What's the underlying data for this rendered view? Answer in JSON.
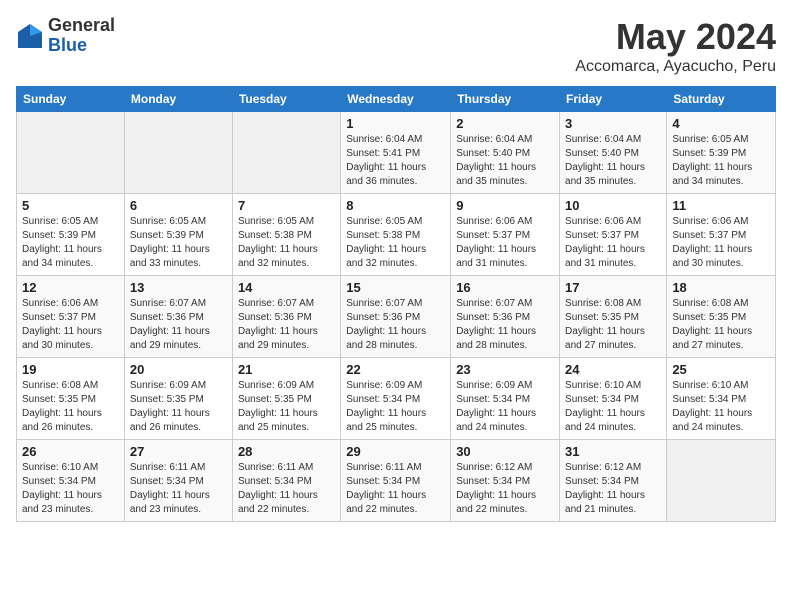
{
  "logo": {
    "general": "General",
    "blue": "Blue"
  },
  "title": "May 2024",
  "subtitle": "Accomarca, Ayacucho, Peru",
  "days_of_week": [
    "Sunday",
    "Monday",
    "Tuesday",
    "Wednesday",
    "Thursday",
    "Friday",
    "Saturday"
  ],
  "weeks": [
    [
      {
        "day": "",
        "info": ""
      },
      {
        "day": "",
        "info": ""
      },
      {
        "day": "",
        "info": ""
      },
      {
        "day": "1",
        "info": "Sunrise: 6:04 AM\nSunset: 5:41 PM\nDaylight: 11 hours and 36 minutes."
      },
      {
        "day": "2",
        "info": "Sunrise: 6:04 AM\nSunset: 5:40 PM\nDaylight: 11 hours and 35 minutes."
      },
      {
        "day": "3",
        "info": "Sunrise: 6:04 AM\nSunset: 5:40 PM\nDaylight: 11 hours and 35 minutes."
      },
      {
        "day": "4",
        "info": "Sunrise: 6:05 AM\nSunset: 5:39 PM\nDaylight: 11 hours and 34 minutes."
      }
    ],
    [
      {
        "day": "5",
        "info": "Sunrise: 6:05 AM\nSunset: 5:39 PM\nDaylight: 11 hours and 34 minutes."
      },
      {
        "day": "6",
        "info": "Sunrise: 6:05 AM\nSunset: 5:39 PM\nDaylight: 11 hours and 33 minutes."
      },
      {
        "day": "7",
        "info": "Sunrise: 6:05 AM\nSunset: 5:38 PM\nDaylight: 11 hours and 32 minutes."
      },
      {
        "day": "8",
        "info": "Sunrise: 6:05 AM\nSunset: 5:38 PM\nDaylight: 11 hours and 32 minutes."
      },
      {
        "day": "9",
        "info": "Sunrise: 6:06 AM\nSunset: 5:37 PM\nDaylight: 11 hours and 31 minutes."
      },
      {
        "day": "10",
        "info": "Sunrise: 6:06 AM\nSunset: 5:37 PM\nDaylight: 11 hours and 31 minutes."
      },
      {
        "day": "11",
        "info": "Sunrise: 6:06 AM\nSunset: 5:37 PM\nDaylight: 11 hours and 30 minutes."
      }
    ],
    [
      {
        "day": "12",
        "info": "Sunrise: 6:06 AM\nSunset: 5:37 PM\nDaylight: 11 hours and 30 minutes."
      },
      {
        "day": "13",
        "info": "Sunrise: 6:07 AM\nSunset: 5:36 PM\nDaylight: 11 hours and 29 minutes."
      },
      {
        "day": "14",
        "info": "Sunrise: 6:07 AM\nSunset: 5:36 PM\nDaylight: 11 hours and 29 minutes."
      },
      {
        "day": "15",
        "info": "Sunrise: 6:07 AM\nSunset: 5:36 PM\nDaylight: 11 hours and 28 minutes."
      },
      {
        "day": "16",
        "info": "Sunrise: 6:07 AM\nSunset: 5:36 PM\nDaylight: 11 hours and 28 minutes."
      },
      {
        "day": "17",
        "info": "Sunrise: 6:08 AM\nSunset: 5:35 PM\nDaylight: 11 hours and 27 minutes."
      },
      {
        "day": "18",
        "info": "Sunrise: 6:08 AM\nSunset: 5:35 PM\nDaylight: 11 hours and 27 minutes."
      }
    ],
    [
      {
        "day": "19",
        "info": "Sunrise: 6:08 AM\nSunset: 5:35 PM\nDaylight: 11 hours and 26 minutes."
      },
      {
        "day": "20",
        "info": "Sunrise: 6:09 AM\nSunset: 5:35 PM\nDaylight: 11 hours and 26 minutes."
      },
      {
        "day": "21",
        "info": "Sunrise: 6:09 AM\nSunset: 5:35 PM\nDaylight: 11 hours and 25 minutes."
      },
      {
        "day": "22",
        "info": "Sunrise: 6:09 AM\nSunset: 5:34 PM\nDaylight: 11 hours and 25 minutes."
      },
      {
        "day": "23",
        "info": "Sunrise: 6:09 AM\nSunset: 5:34 PM\nDaylight: 11 hours and 24 minutes."
      },
      {
        "day": "24",
        "info": "Sunrise: 6:10 AM\nSunset: 5:34 PM\nDaylight: 11 hours and 24 minutes."
      },
      {
        "day": "25",
        "info": "Sunrise: 6:10 AM\nSunset: 5:34 PM\nDaylight: 11 hours and 24 minutes."
      }
    ],
    [
      {
        "day": "26",
        "info": "Sunrise: 6:10 AM\nSunset: 5:34 PM\nDaylight: 11 hours and 23 minutes."
      },
      {
        "day": "27",
        "info": "Sunrise: 6:11 AM\nSunset: 5:34 PM\nDaylight: 11 hours and 23 minutes."
      },
      {
        "day": "28",
        "info": "Sunrise: 6:11 AM\nSunset: 5:34 PM\nDaylight: 11 hours and 22 minutes."
      },
      {
        "day": "29",
        "info": "Sunrise: 6:11 AM\nSunset: 5:34 PM\nDaylight: 11 hours and 22 minutes."
      },
      {
        "day": "30",
        "info": "Sunrise: 6:12 AM\nSunset: 5:34 PM\nDaylight: 11 hours and 22 minutes."
      },
      {
        "day": "31",
        "info": "Sunrise: 6:12 AM\nSunset: 5:34 PM\nDaylight: 11 hours and 21 minutes."
      },
      {
        "day": "",
        "info": ""
      }
    ]
  ]
}
